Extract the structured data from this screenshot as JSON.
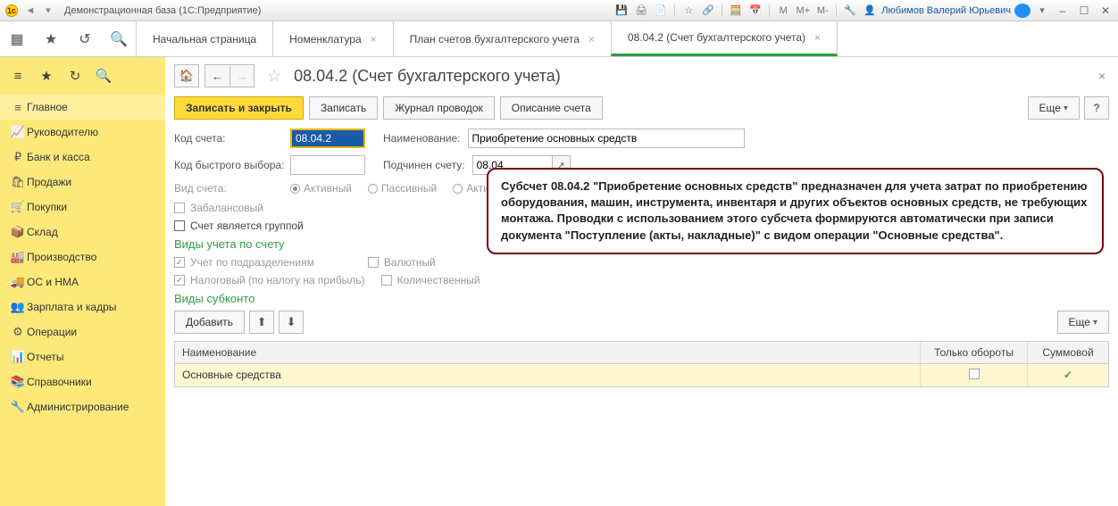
{
  "titlebar": {
    "title": "Демонстрационная база  (1С:Предприятие)",
    "user": "Любимов Валерий Юрьевич",
    "m_labels": [
      "M",
      "M+",
      "M-"
    ]
  },
  "top_tabs": {
    "t0": "Начальная страница",
    "t1": "Номенклатура",
    "t2": "План счетов бухгалтерского учета",
    "t3": "08.04.2 (Счет бухгалтерского учета)"
  },
  "sidebar": {
    "items": [
      {
        "icon": "≡",
        "label": "Главное"
      },
      {
        "icon": "📈",
        "label": "Руководителю"
      },
      {
        "icon": "₽",
        "label": "Банк и касса"
      },
      {
        "icon": "🛍",
        "label": "Продажи"
      },
      {
        "icon": "🛒",
        "label": "Покупки"
      },
      {
        "icon": "📦",
        "label": "Склад"
      },
      {
        "icon": "🏭",
        "label": "Производство"
      },
      {
        "icon": "🚚",
        "label": "ОС и НМА"
      },
      {
        "icon": "👥",
        "label": "Зарплата и кадры"
      },
      {
        "icon": "⚙",
        "label": "Операции"
      },
      {
        "icon": "📊",
        "label": "Отчеты"
      },
      {
        "icon": "📚",
        "label": "Справочники"
      },
      {
        "icon": "🔧",
        "label": "Администрирование"
      }
    ]
  },
  "page": {
    "title": "08.04.2 (Счет бухгалтерского учета)",
    "actions": {
      "save_close": "Записать и закрыть",
      "save": "Записать",
      "journal": "Журнал проводок",
      "desc": "Описание счета",
      "more": "Еще",
      "q": "?"
    },
    "labels": {
      "code": "Код счета:",
      "name": "Наименование:",
      "quick": "Код быстрого выбора:",
      "parent": "Подчинен счету:",
      "kind": "Вид счета:",
      "kinds": {
        "a": "Активный",
        "p": "Пассивный",
        "ap": "Активный/Пассивный"
      },
      "offbalance": "Забалансовый",
      "isgroup": "Счет является группой",
      "sec1": "Виды учета по счету",
      "cb_dept": "Учет по подразделениям",
      "cb_tax": "Налоговый (по налогу на прибыль)",
      "cb_val": "Валютный",
      "cb_qty": "Количественный",
      "sec2": "Виды субконто",
      "add": "Добавить"
    },
    "values": {
      "code": "08.04.2",
      "name": "Приобретение основных средств",
      "quick": "",
      "parent": "08.04"
    },
    "callout": "Субсчет 08.04.2 \"Приобретение основных средств\" предназначен для учета затрат по приобретению оборудования, машин, инструмента, инвентаря и других объектов основных средств, не требующих монтажа. Проводки с использованием этого субсчета формируются автоматически при записи документа \"Поступление (акты, накладные)\" с видом операции \"Основные средства\".",
    "table": {
      "h1": "Наименование",
      "h2": "Только обороты",
      "h3": "Суммовой",
      "r1": {
        "name": "Основные средства",
        "only": "",
        "sum": "✓"
      }
    }
  }
}
